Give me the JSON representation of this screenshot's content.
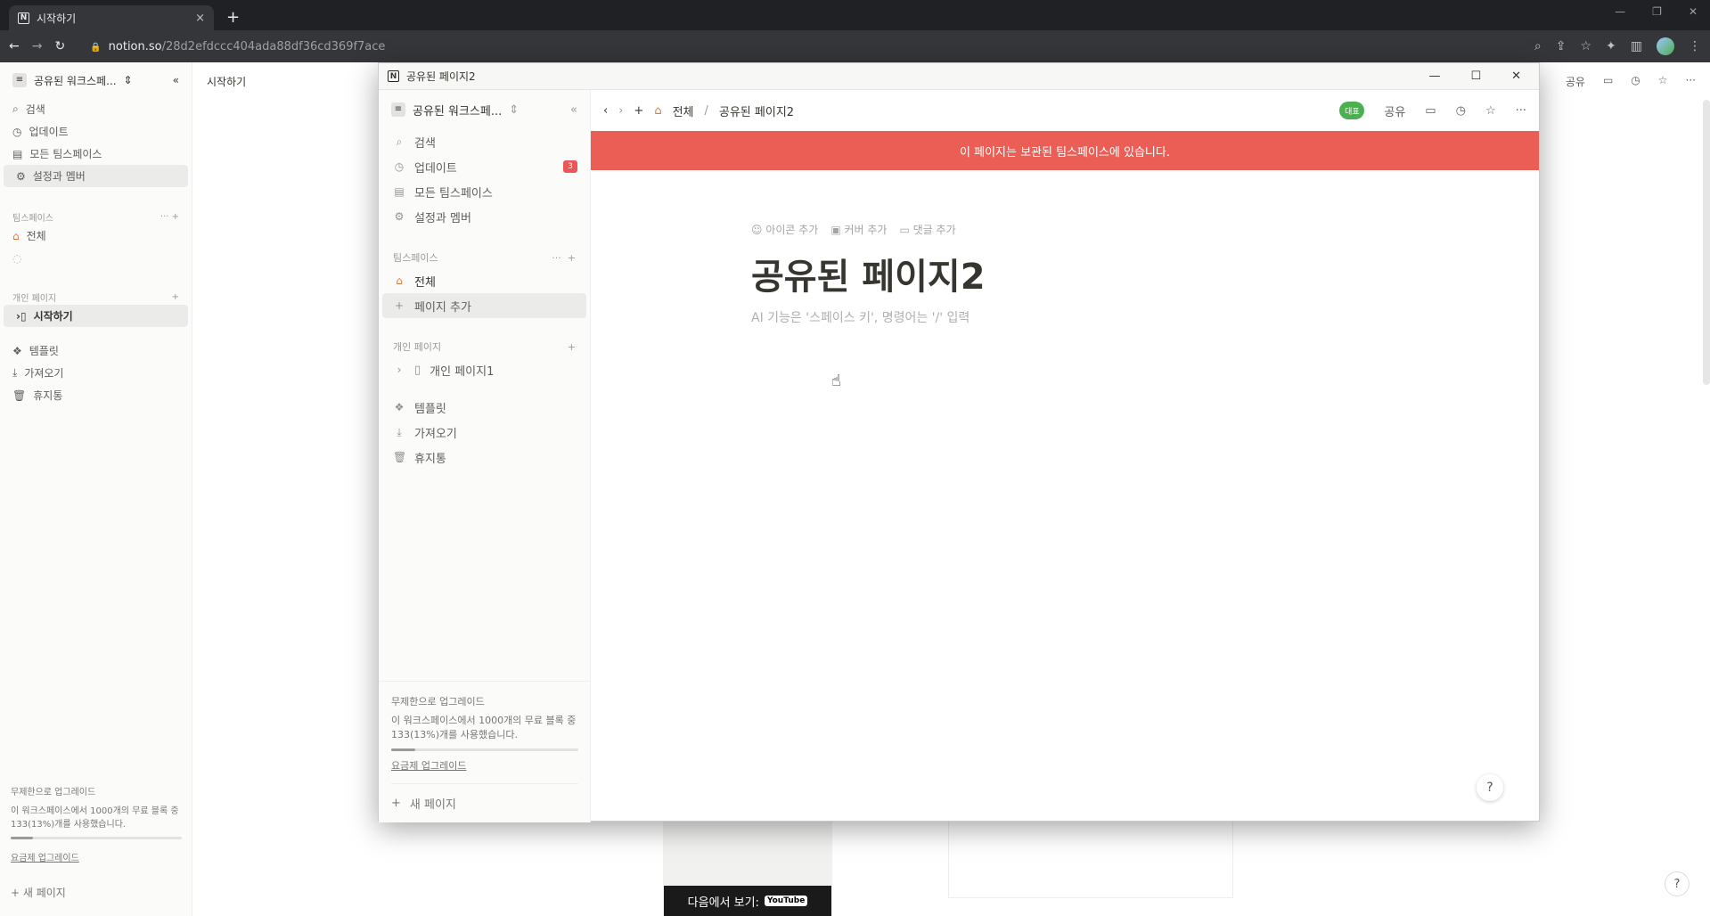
{
  "browser": {
    "tab_title": "시작하기",
    "tab_close": "×",
    "new_tab": "+",
    "url_host": "notion.so",
    "url_path": "/28d2efdccc404ada88df36cd369f7ace"
  },
  "background": {
    "workspace_name": "공유된 워크스페...",
    "nav": [
      "검색",
      "업데이트",
      "모든 팀스페이스",
      "설정과 멤버"
    ],
    "teamspace_label": "팀스페이스",
    "teamspace_items": [
      "전체"
    ],
    "private_label": "개인 페이지",
    "private_items": [
      "시작하기"
    ],
    "extras": [
      "템플릿",
      "가져오기",
      "휴지통"
    ],
    "page_title": "시작하기",
    "share": "공유",
    "upgrade_title": "무제한으로 업그레이드",
    "upgrade_desc": "이 워크스페이스에서 1000개의 무료 블록 중 133(13%)개를 사용했습니다.",
    "upgrade_link": "요금제 업그레이드",
    "new_page": "새 페이지",
    "youtube_text": "다음에서 보기:",
    "youtube_logo": "YouTube",
    "help": "?"
  },
  "popup": {
    "window_title": "공유된 페이지2",
    "sidebar": {
      "workspace_name": "공유된 워크스페...",
      "nav": [
        {
          "label": "검색",
          "icon": "search-icon"
        },
        {
          "label": "업데이트",
          "icon": "clock-icon",
          "badge": "3"
        },
        {
          "label": "모든 팀스페이스",
          "icon": "building-icon"
        },
        {
          "label": "설정과 멤버",
          "icon": "gear-icon"
        }
      ],
      "teamspace_label": "팀스페이스",
      "teamspace_items": [
        "전체",
        "페이지 추가"
      ],
      "private_label": "개인 페이지",
      "private_items": [
        "개인 페이지1"
      ],
      "extras": [
        "템플릿",
        "가져오기",
        "휴지통"
      ],
      "upgrade_title": "무제한으로 업그레이드",
      "upgrade_desc": "이 워크스페이스에서 1000개의 무료 블록 중 133(13%)개를 사용했습니다.",
      "upgrade_progress": 0.13,
      "upgrade_link": "요금제 업그레이드",
      "new_page": "새 페이지"
    },
    "topbar": {
      "breadcrumb_parent": "전체",
      "breadcrumb_sep": "/",
      "breadcrumb_current": "공유된 페이지2",
      "avatar_text": "대표",
      "share": "공유"
    },
    "banner": "이 페이지는 보관된 팀스페이스에 있습니다.",
    "doc": {
      "add_icon": "아이콘 추가",
      "add_cover": "커버 추가",
      "add_comment": "댓글 추가",
      "title": "공유된 페이지2",
      "placeholder": "AI 기능은 '스페이스 키', 명령어는 '/' 입력"
    },
    "help": "?"
  },
  "colors": {
    "banner": "#eb5e55",
    "badge": "#eb5757",
    "chrome_dark": "#202124"
  }
}
